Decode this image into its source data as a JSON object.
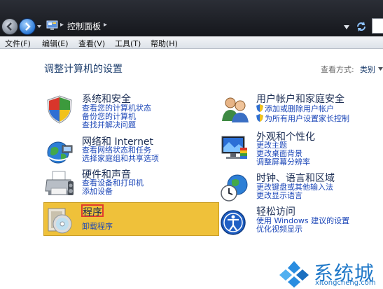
{
  "window": {
    "address": "控制面板"
  },
  "menu": {
    "items": [
      "文件(F)",
      "编辑(E)",
      "查看(V)",
      "工具(T)",
      "帮助(H)"
    ]
  },
  "page": {
    "title": "调整计算机的设置",
    "view_by_label": "查看方式:",
    "view_by_value": "类别"
  },
  "categories": {
    "system": {
      "title": "系统和安全",
      "links": [
        "查看您的计算机状态",
        "备份您的计算机",
        "查找并解决问题"
      ],
      "icon": "shield-icon"
    },
    "network": {
      "title": "网络和 Internet",
      "links": [
        "查看网络状态和任务",
        "选择家庭组和共享选项"
      ],
      "icon": "network-globe-icon"
    },
    "hardware": {
      "title": "硬件和声音",
      "links": [
        "查看设备和打印机",
        "添加设备"
      ],
      "icon": "printer-icon"
    },
    "programs": {
      "title": "程序",
      "links": [
        "卸载程序"
      ],
      "icon": "programs-disc-icon"
    },
    "users": {
      "title": "用户帐户和家庭安全",
      "links": [
        "添加或删除用户帐户",
        "为所有用户设置家长控制"
      ],
      "icon": "users-icon"
    },
    "appearance": {
      "title": "外观和个性化",
      "links": [
        "更改主题",
        "更改桌面背景",
        "调整屏幕分辨率"
      ],
      "icon": "monitor-icon"
    },
    "clock": {
      "title": "时钟、语言和区域",
      "links": [
        "更改键盘或其他输入法",
        "更改显示语言"
      ],
      "icon": "clock-globe-icon"
    },
    "access": {
      "title": "轻松访问",
      "links": [
        "使用 Windows 建议的设置",
        "优化视频显示"
      ],
      "icon": "ease-of-access-icon"
    }
  },
  "watermark": {
    "name": "系统城",
    "url": "xitongcheng.com"
  },
  "colors": {
    "link": "#1c47b8",
    "title": "#1d2f55",
    "highlight": "#efc13a",
    "highlight_border": "#e23b2e"
  }
}
